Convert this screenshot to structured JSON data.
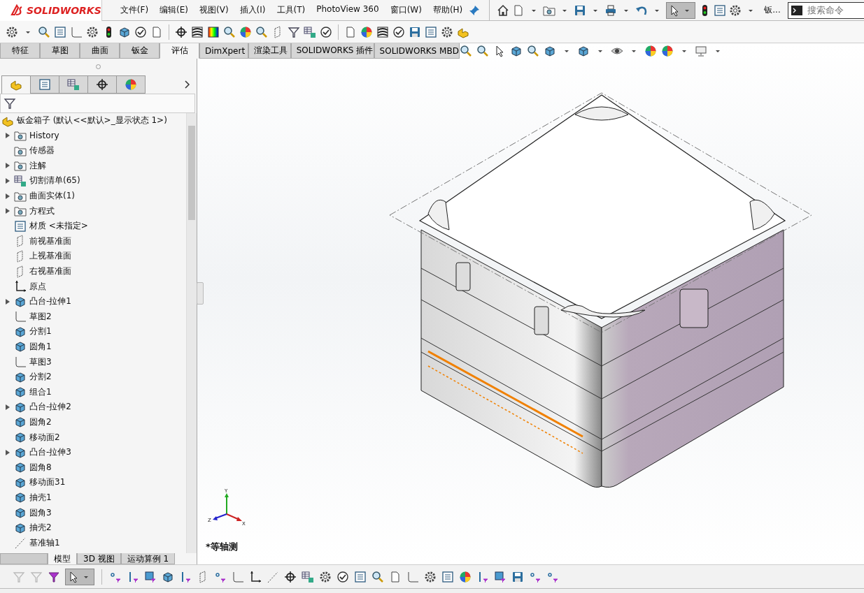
{
  "app_logo": {
    "text": "SOLIDWORKS"
  },
  "menu": [
    "文件(F)",
    "编辑(E)",
    "视图(V)",
    "插入(I)",
    "工具(T)",
    "PhotoView 360",
    "窗口(W)",
    "帮助(H)"
  ],
  "quick_access": {
    "document_label": "钣...",
    "search": {
      "placeholder": "搜索命令"
    }
  },
  "command_tabs": [
    {
      "label": "特征",
      "selected": false
    },
    {
      "label": "草图",
      "selected": false
    },
    {
      "label": "曲面",
      "selected": false
    },
    {
      "label": "钣金",
      "selected": false
    },
    {
      "label": "评估",
      "selected": true
    },
    {
      "label": "DimXpert",
      "selected": false
    },
    {
      "label": "渲染工具",
      "selected": false
    },
    {
      "label": "SOLIDWORKS 插件",
      "selected": false
    },
    {
      "label": "SOLIDWORKS MBD",
      "selected": false
    }
  ],
  "feature_tree": {
    "root": "钣金箱子 (默认<<默认>_显示状态 1>)",
    "items": [
      {
        "label": "History",
        "kind": "folder",
        "expandable": true
      },
      {
        "label": "传感器",
        "kind": "folder",
        "expandable": false
      },
      {
        "label": "注解",
        "kind": "folder",
        "expandable": true
      },
      {
        "label": "切割清单(65)",
        "kind": "table",
        "expandable": true
      },
      {
        "label": "曲面实体(1)",
        "kind": "folder",
        "expandable": true
      },
      {
        "label": "方程式",
        "kind": "folder",
        "expandable": true
      },
      {
        "label": "材质 <未指定>",
        "kind": "material",
        "expandable": false
      },
      {
        "label": "前视基准面",
        "kind": "plane",
        "expandable": false
      },
      {
        "label": "上视基准面",
        "kind": "plane",
        "expandable": false
      },
      {
        "label": "右视基准面",
        "kind": "plane",
        "expandable": false
      },
      {
        "label": "原点",
        "kind": "origin",
        "expandable": false
      },
      {
        "label": "凸台-拉伸1",
        "kind": "feature",
        "expandable": true
      },
      {
        "label": "草图2",
        "kind": "sketch",
        "expandable": false
      },
      {
        "label": "分割1",
        "kind": "feature",
        "expandable": false
      },
      {
        "label": "圆角1",
        "kind": "feature",
        "expandable": false
      },
      {
        "label": "草图3",
        "kind": "sketch",
        "expandable": false
      },
      {
        "label": "分割2",
        "kind": "feature",
        "expandable": false
      },
      {
        "label": "组合1",
        "kind": "feature",
        "expandable": false
      },
      {
        "label": "凸台-拉伸2",
        "kind": "feature",
        "expandable": true
      },
      {
        "label": "圆角2",
        "kind": "feature",
        "expandable": false
      },
      {
        "label": "移动面2",
        "kind": "feature",
        "expandable": false
      },
      {
        "label": "凸台-拉伸3",
        "kind": "feature",
        "expandable": true
      },
      {
        "label": "圆角8",
        "kind": "feature",
        "expandable": false
      },
      {
        "label": "移动面31",
        "kind": "feature",
        "expandable": false
      },
      {
        "label": "抽壳1",
        "kind": "feature",
        "expandable": false
      },
      {
        "label": "圆角3",
        "kind": "feature",
        "expandable": false
      },
      {
        "label": "抽壳2",
        "kind": "feature",
        "expandable": false
      },
      {
        "label": "基准轴1",
        "kind": "axis",
        "expandable": false
      }
    ]
  },
  "bottom_tabs": [
    {
      "label": "模型",
      "selected": true
    },
    {
      "label": "3D 视图",
      "selected": false
    },
    {
      "label": "运动算例 1",
      "selected": false
    }
  ],
  "viewport": {
    "view_label": "*等轴测",
    "triad": {
      "x": "X",
      "y": "Y",
      "z": "Z"
    }
  }
}
